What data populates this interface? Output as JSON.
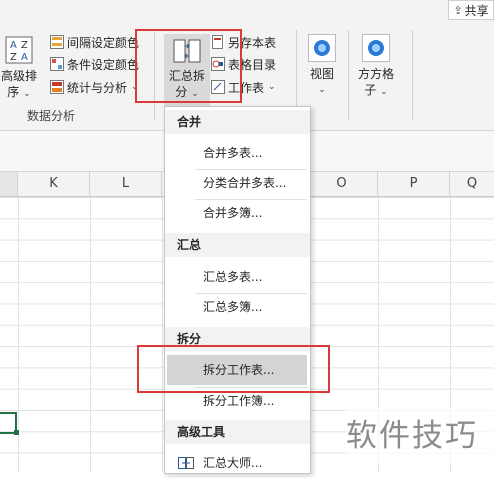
{
  "top_right": {
    "share_label": "共享"
  },
  "ribbon": {
    "sort_group": {
      "label_line1": "高级排",
      "label_line2": "序"
    },
    "format_items": [
      {
        "label": "间隔设定颜色",
        "icon": "grid-color-icon"
      },
      {
        "label": "条件设定颜色",
        "icon": "condition-color-icon"
      },
      {
        "label": "统计与分析",
        "icon": "stats-icon"
      }
    ],
    "group_label": "数据分析",
    "summary_split": {
      "line1": "汇总拆",
      "line2": "分"
    },
    "sheet_items": [
      {
        "label": "另存本表",
        "icon": "save-sheet-icon"
      },
      {
        "label": "表格目录",
        "icon": "sheet-toc-icon"
      },
      {
        "label": "工作表",
        "icon": "worksheet-icon"
      }
    ],
    "view": {
      "label": "视图"
    },
    "fangfang": {
      "line1": "方方格",
      "line2": "子"
    }
  },
  "columns": [
    "K",
    "L",
    "O",
    "P",
    "Q"
  ],
  "menu": {
    "sections": [
      {
        "header": "合并",
        "items": [
          "合并多表...",
          "分类合并多表...",
          "合并多簿..."
        ]
      },
      {
        "header": "汇总",
        "items": [
          "汇总多表...",
          "汇总多簿..."
        ]
      },
      {
        "header": "拆分",
        "items": [
          "拆分工作表...",
          "拆分工作簿..."
        ]
      },
      {
        "header": "高级工具",
        "items": [
          "汇总大师..."
        ]
      }
    ],
    "highlighted": "拆分工作表..."
  },
  "watermark": "软件技巧",
  "colors": {
    "annotation_red": "#d93a3a",
    "ribbon_bg": "#f3f3f3",
    "highlight": "#d4d4d4"
  }
}
